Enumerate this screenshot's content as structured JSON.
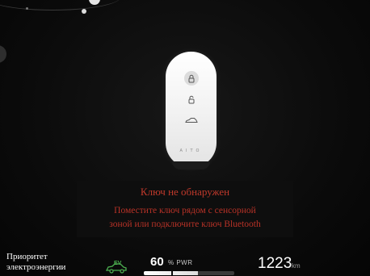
{
  "key_fob": {
    "brand": "AITO",
    "buttons": [
      {
        "icon": "lock-icon"
      },
      {
        "icon": "unlock-icon"
      },
      {
        "icon": "car-trunk-icon"
      }
    ]
  },
  "message": {
    "title": "Ключ не обнаружен",
    "hint_line1": "Поместите ключ рядом с сенсорной",
    "hint_line2": "зоной или подключите ключ Bluetooth"
  },
  "status_bar": {
    "priority_line1": "Приоритет",
    "priority_line2": "электроэнергии",
    "ev_icon": "ev-car-icon",
    "ev_badge": "EV",
    "power_value": "60",
    "power_unit": "% PWR",
    "power_fraction": 0.6,
    "range_value": "1223",
    "range_unit": "km"
  },
  "colors": {
    "alert_red": "#c0392b",
    "ev_green": "#4caf50",
    "background": "#0b0b0b"
  }
}
